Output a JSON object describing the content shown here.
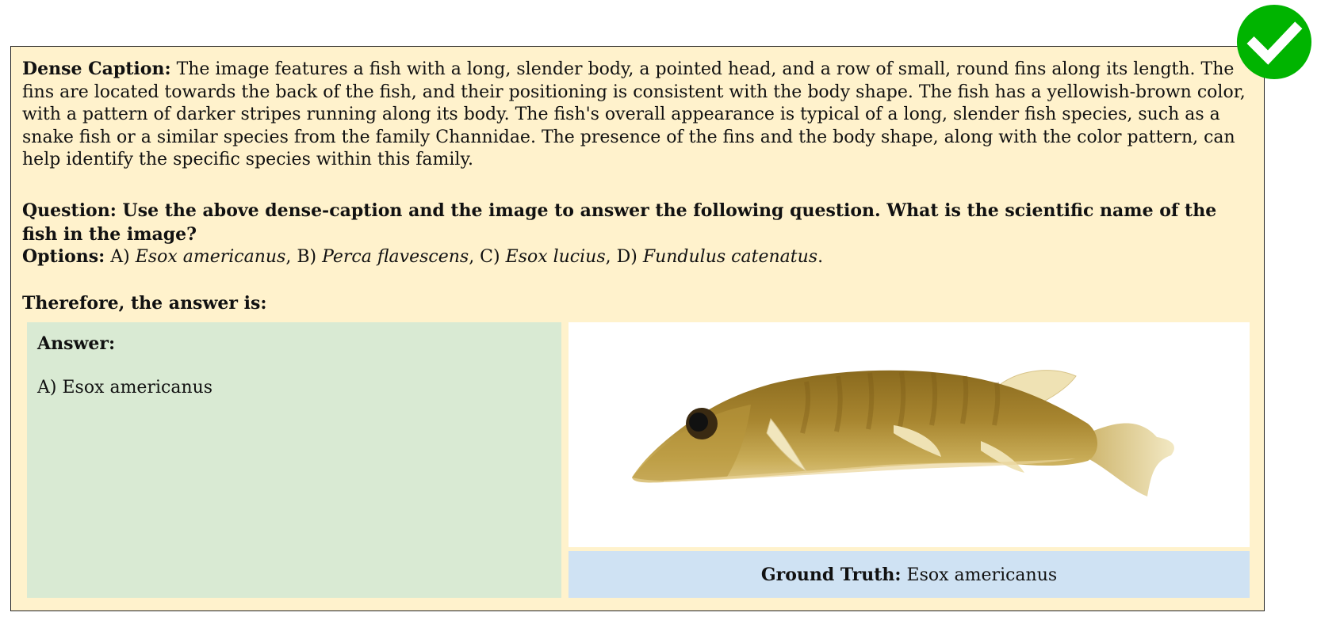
{
  "caption": {
    "label": "Dense Caption:",
    "text": " The image features a fish with a long, slender body, a pointed head, and a row of small, round fins along its length. The fins are located towards the back of the fish, and their positioning is consistent with the body shape. The fish has a yellowish-brown color, with a pattern of darker stripes running along its body. The fish's overall appearance is typical of a long, slender fish species, such as a snake fish or a similar species from the family Channidae. The presence of the fins and the body shape, along with the color pattern, can help identify the specific species within this family."
  },
  "question": {
    "text": "Question: Use the above dense-caption and the image to answer the following question. What is the scientific name of the fish in the image?"
  },
  "options": {
    "label": "Options:",
    "a_prefix": " A) ",
    "a": "Esox americanus",
    "b_prefix": ", B) ",
    "b": "Perca flavescens",
    "c_prefix": ", C) ",
    "c": "Esox lucius",
    "d_prefix": ", D) ",
    "d": "Fundulus catenatus",
    "end": "."
  },
  "therefore": "Therefore, the answer is:",
  "answer": {
    "label": "Answer:",
    "text": "A) Esox americanus"
  },
  "ground_truth": {
    "label": "Ground Truth:",
    "text": " Esox americanus"
  },
  "colors": {
    "card_bg": "#fff2cc",
    "answer_bg": "#d9ead3",
    "gt_bg": "#cfe2f3",
    "check_green": "#00b400"
  },
  "icons": {
    "status": "checkmark-icon"
  }
}
